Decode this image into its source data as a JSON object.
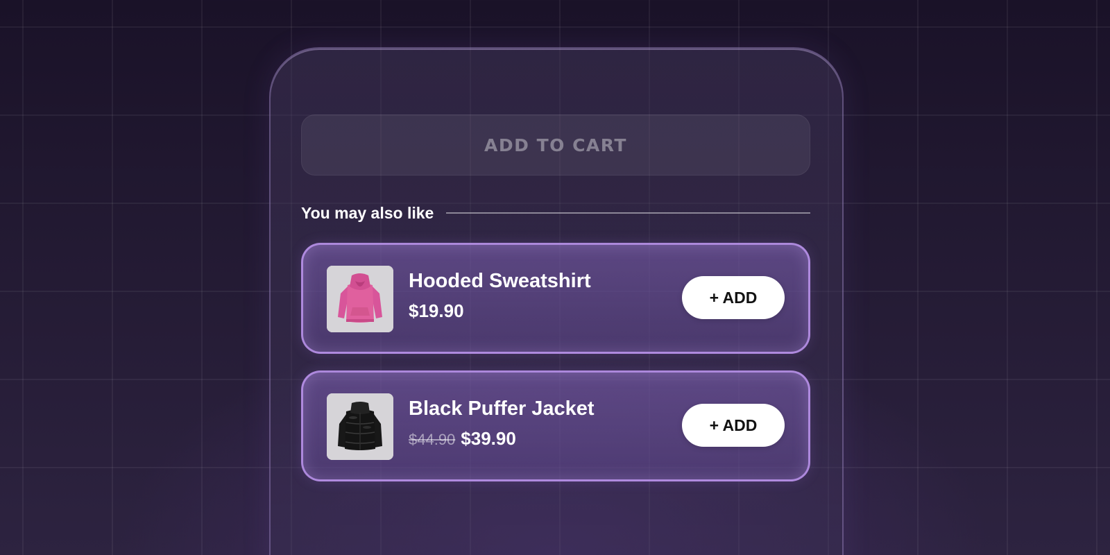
{
  "cart": {
    "add_to_cart_label": "ADD TO CART"
  },
  "recommendations": {
    "heading": "You may also like",
    "items": [
      {
        "name": "Hooded Sweatshirt",
        "price": "$19.90",
        "original_price": "",
        "image_icon": "pink-hoodie-image",
        "add_label": "+ ADD"
      },
      {
        "name": "Black Puffer Jacket",
        "price": "$39.90",
        "original_price": "$44.90",
        "image_icon": "black-puffer-jacket-image",
        "add_label": "+ ADD"
      }
    ]
  },
  "colors": {
    "card_border": "#be96f0",
    "add_button_bg": "#ffffff",
    "hoodie": "#e0609e",
    "jacket": "#141414"
  }
}
